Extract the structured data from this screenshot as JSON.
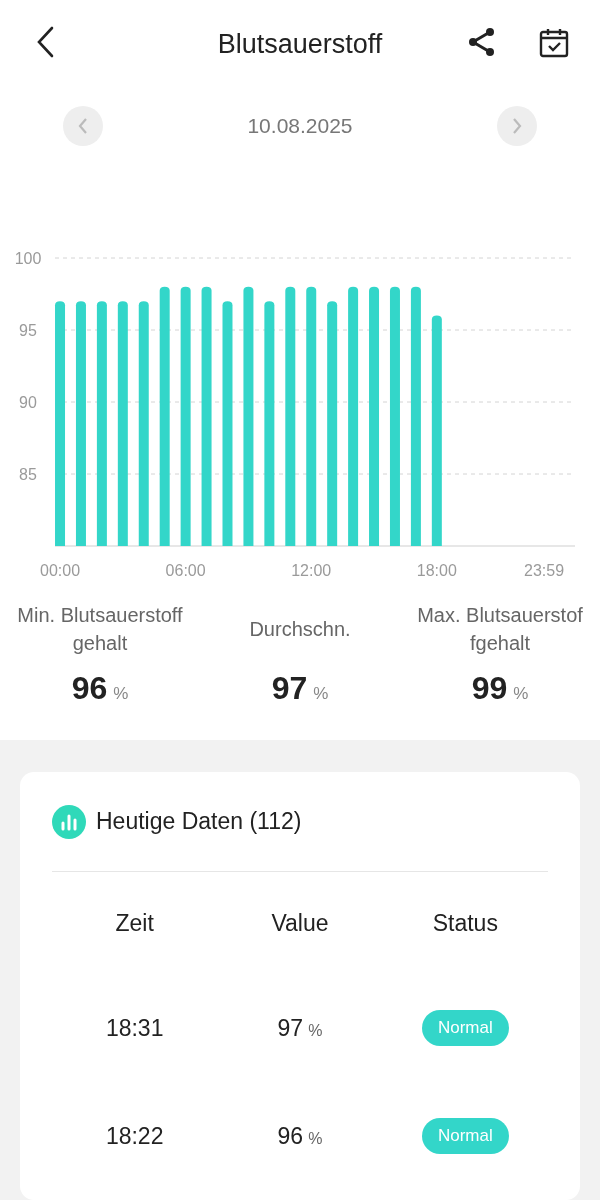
{
  "header": {
    "title": "Blutsauerstoff"
  },
  "date_nav": {
    "date": "10.08.2025"
  },
  "chart_data": {
    "type": "bar",
    "x": [
      0,
      1,
      2,
      3,
      4,
      5,
      6,
      7,
      8,
      9,
      10,
      11,
      12,
      13,
      14,
      15,
      16,
      17,
      18
    ],
    "xlim": [
      -0.24,
      24.6
    ],
    "grid": true,
    "series": [
      {
        "color": "#33d6c9",
        "values": [
          97,
          97,
          97,
          97,
          97,
          98,
          98,
          98,
          97,
          98,
          97,
          98,
          98,
          97,
          98,
          98,
          98,
          98,
          96
        ]
      }
    ],
    "ylim": [
      80,
      100
    ],
    "yticks": [
      85,
      90,
      95,
      100
    ],
    "xticks": [
      {
        "value": 0,
        "label": "00:00"
      },
      {
        "value": 6,
        "label": "06:00"
      },
      {
        "value": 12,
        "label": "12:00"
      },
      {
        "value": 18,
        "label": "18:00"
      },
      {
        "value": 23.983,
        "label": "23:59"
      }
    ]
  },
  "stats": [
    {
      "label_lines": [
        "Min. Blutsauerstoff",
        "gehalt"
      ],
      "value": "96",
      "unit": "%"
    },
    {
      "label_lines": [
        "Durchschn."
      ],
      "value": "97",
      "unit": "%"
    },
    {
      "label_lines": [
        "Max. Blutsauerstof",
        "fgehalt"
      ],
      "value": "99",
      "unit": "%"
    }
  ],
  "today": {
    "title": "Heutige Daten (112)",
    "columns": [
      "Zeit",
      "Value",
      "Status"
    ],
    "rows": [
      {
        "time": "18:31",
        "value": "97",
        "unit": "%",
        "status": "Normal"
      },
      {
        "time": "18:22",
        "value": "96",
        "unit": "%",
        "status": "Normal"
      }
    ]
  }
}
